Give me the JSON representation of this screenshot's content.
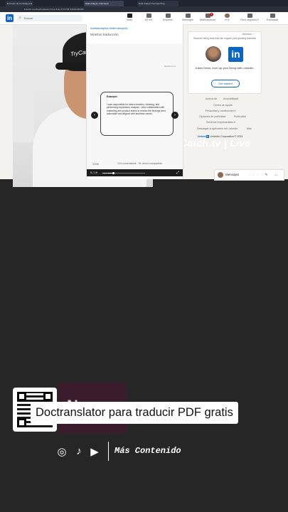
{
  "brand": "// TryCatch.tv | Live",
  "webcam": {
    "cap_text": "TryCatch.tv"
  },
  "browser": {
    "tabs": [
      "El Futuro de la inteligencia",
      "Data Analyst | Interviews",
      "Data Analyst Interview Prep"
    ],
    "address": "linkedin.com/feed/update/urn:li:activity:7171736719694438400/"
  },
  "linkedin": {
    "search_placeholder": "Buscar",
    "nav": [
      {
        "label": "Inicio",
        "badge": ""
      },
      {
        "label": "Mi red",
        "badge": ""
      },
      {
        "label": "Empleos",
        "badge": ""
      },
      {
        "label": "Mensajes",
        "badge": ""
      },
      {
        "label": "Notificaciones",
        "badge": "5"
      },
      {
        "label": "Yo ▾",
        "badge": ""
      },
      {
        "label": "Para negocios ▾",
        "badge": ""
      },
      {
        "label": "Publicidad",
        "badge": ""
      }
    ],
    "post": {
      "hashtags": "#dataanalytics #interviewprep",
      "show_translation": "Mostrar traducción",
      "doc_corner": "datafocus.tv",
      "example_title": "Example:",
      "example_body": "I was responsible for data extraction, cleaning, and performing exploratory analysis. I also collaborated with marketing and product teams to ensure the findings were actionable and aligned with business needs.",
      "page_indicator": "5 / 19",
      "progress": 0.26,
      "reactions_count": "1056",
      "comments": "124 comentarios · 91 veces compartido",
      "reactions_label": "Reacciones"
    },
    "ad": {
      "label": "Anuncio ···",
      "subtitle": "Discover hiring tools that can support your growing business",
      "headline": "Julian Denis, level up your hiring with LinkedIn.",
      "cta": "Get started",
      "logo_text": "in"
    },
    "footer": {
      "row1": [
        "Acerca de",
        "Accesibilidad"
      ],
      "row2": [
        "Centro de ayuda"
      ],
      "row3": [
        "Privacidad y condiciones ▾"
      ],
      "row4": [
        "Opciones de publicidad",
        "Publicidad"
      ],
      "row5": [
        "Servicios empresariales ▾"
      ],
      "row6": [
        "Descargar la aplicación de LinkedIn",
        "Más"
      ],
      "copyright": "LinkedIn Corporation © 2024"
    },
    "messaging": {
      "label": "Mensajes",
      "icons": "··· ✎ ︿"
    }
  },
  "caption": "Doctranslator para traducir PDF gratis",
  "social": {
    "instagram": "◎",
    "tiktok": "♪",
    "youtube": "▶"
  },
  "more": "Más Contenido"
}
